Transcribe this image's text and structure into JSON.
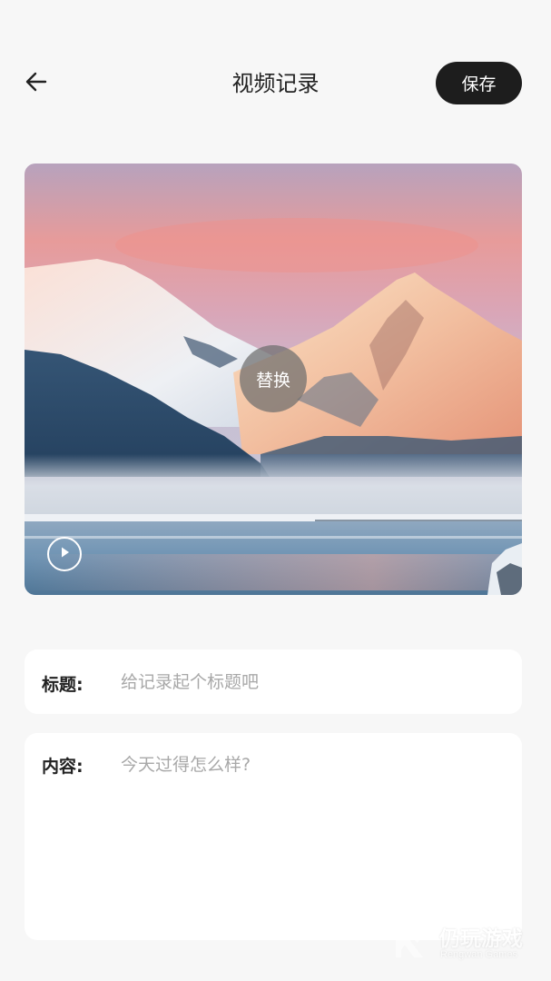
{
  "header": {
    "back_icon": "arrow-left-icon",
    "title": "视频记录",
    "save_label": "保存"
  },
  "media": {
    "replace_label": "替换",
    "play_icon": "play-circle-icon"
  },
  "form": {
    "title_label": "标题:",
    "title_placeholder": "给记录起个标题吧",
    "title_value": "",
    "content_label": "内容:",
    "content_placeholder": "今天过得怎么样?",
    "content_value": ""
  },
  "watermark": {
    "brand": "仍玩游戏",
    "brand_en": "Rengwan Games"
  },
  "colors": {
    "background": "#f7f7f7",
    "save_button": "#1d1d1d",
    "card": "#ffffff",
    "placeholder": "#a8a8a8"
  }
}
